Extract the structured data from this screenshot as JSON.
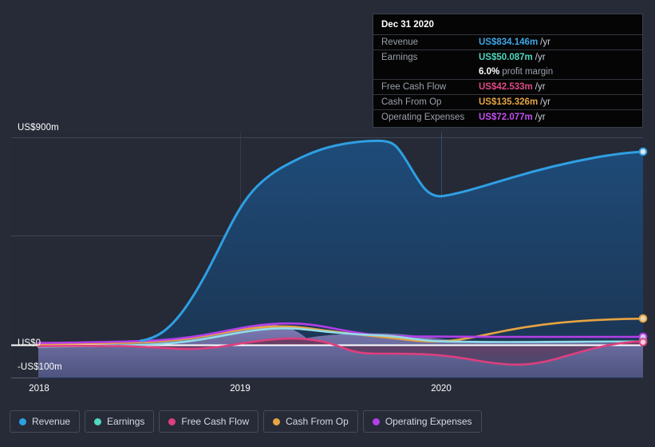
{
  "chart_data": {
    "type": "area",
    "title": "",
    "xlabel": "",
    "ylabel": "",
    "x_ticks": [
      "2018",
      "2019",
      "2020"
    ],
    "y_ticks": [
      "US$900m",
      "US$0",
      "-US$100m"
    ],
    "ylim": [
      -100,
      900
    ],
    "y_unit": "US$m",
    "grid": true,
    "legend_position": "bottom",
    "series": [
      {
        "name": "Revenue",
        "color": "#2f9fe3",
        "end_value": 834.146,
        "values": [
          4,
          5,
          6,
          8,
          12,
          30,
          95,
          230,
          420,
          590,
          700,
          770,
          800,
          800,
          770,
          640,
          590,
          600,
          630,
          670,
          710,
          760,
          800,
          820,
          834
        ]
      },
      {
        "name": "Earnings",
        "color": "#4fd8c0",
        "end_value": 50.087,
        "values": [
          -5,
          -5,
          -4,
          -3,
          -2,
          0,
          4,
          10,
          18,
          26,
          34,
          40,
          44,
          45,
          42,
          36,
          32,
          30,
          32,
          36,
          40,
          44,
          47,
          49,
          50
        ]
      },
      {
        "name": "Free Cash Flow",
        "color": "#de3f7e",
        "end_value": 42.533,
        "values": [
          -6,
          -6,
          -6,
          -6,
          -5,
          -4,
          -2,
          2,
          8,
          16,
          22,
          25,
          26,
          24,
          16,
          2,
          -8,
          -16,
          -20,
          -18,
          -10,
          4,
          20,
          34,
          42
        ]
      },
      {
        "name": "Cash From Op",
        "color": "#e6a442",
        "end_value": 135.326,
        "values": [
          -4,
          -4,
          -3,
          -2,
          0,
          4,
          12,
          24,
          36,
          48,
          58,
          66,
          72,
          74,
          72,
          66,
          60,
          56,
          56,
          62,
          74,
          90,
          108,
          124,
          135
        ]
      },
      {
        "name": "Operating Expenses",
        "color": "#b23fe8",
        "end_value": 72.077,
        "values": [
          2,
          2,
          3,
          4,
          6,
          10,
          18,
          28,
          38,
          46,
          54,
          60,
          64,
          66,
          66,
          64,
          62,
          60,
          60,
          62,
          64,
          66,
          68,
          70,
          72
        ]
      }
    ]
  },
  "tooltip": {
    "title": "Dec 31 2020",
    "rows": [
      {
        "label": "Revenue",
        "value": "US$834.146m",
        "unit": "/yr",
        "color": "#3da6e8"
      },
      {
        "label": "Earnings",
        "value": "US$50.087m",
        "unit": "/yr",
        "color": "#4fd8c0"
      },
      {
        "label": "",
        "value": "6.0%",
        "unit": "",
        "suffix": "profit margin",
        "color": "#ffffff"
      },
      {
        "label": "Free Cash Flow",
        "value": "US$42.533m",
        "unit": "/yr",
        "color": "#e04a86"
      },
      {
        "label": "Cash From Op",
        "value": "US$135.326m",
        "unit": "/yr",
        "color": "#e6a442"
      },
      {
        "label": "Operating Expenses",
        "value": "US$72.077m",
        "unit": "/yr",
        "color": "#c14ff0"
      }
    ]
  },
  "legend": {
    "items": [
      {
        "label": "Revenue",
        "color": "#2f9fe3"
      },
      {
        "label": "Earnings",
        "color": "#4fd8c0"
      },
      {
        "label": "Free Cash Flow",
        "color": "#de3f7e"
      },
      {
        "label": "Cash From Op",
        "color": "#e6a442"
      },
      {
        "label": "Operating Expenses",
        "color": "#b23fe8"
      }
    ]
  },
  "axis": {
    "y_top_label": "US$900m",
    "y_zero_label": "US$0",
    "y_bottom_label": "-US$100m",
    "x_2018": "2018",
    "x_2019": "2019",
    "x_2020": "2020"
  },
  "colors": {
    "background": "#272b38",
    "plot_fill_top": "#1d4368",
    "plot_fill_bottom": "#1f3352",
    "gridline": "#3c4150",
    "zero_line": "#ffffff"
  }
}
